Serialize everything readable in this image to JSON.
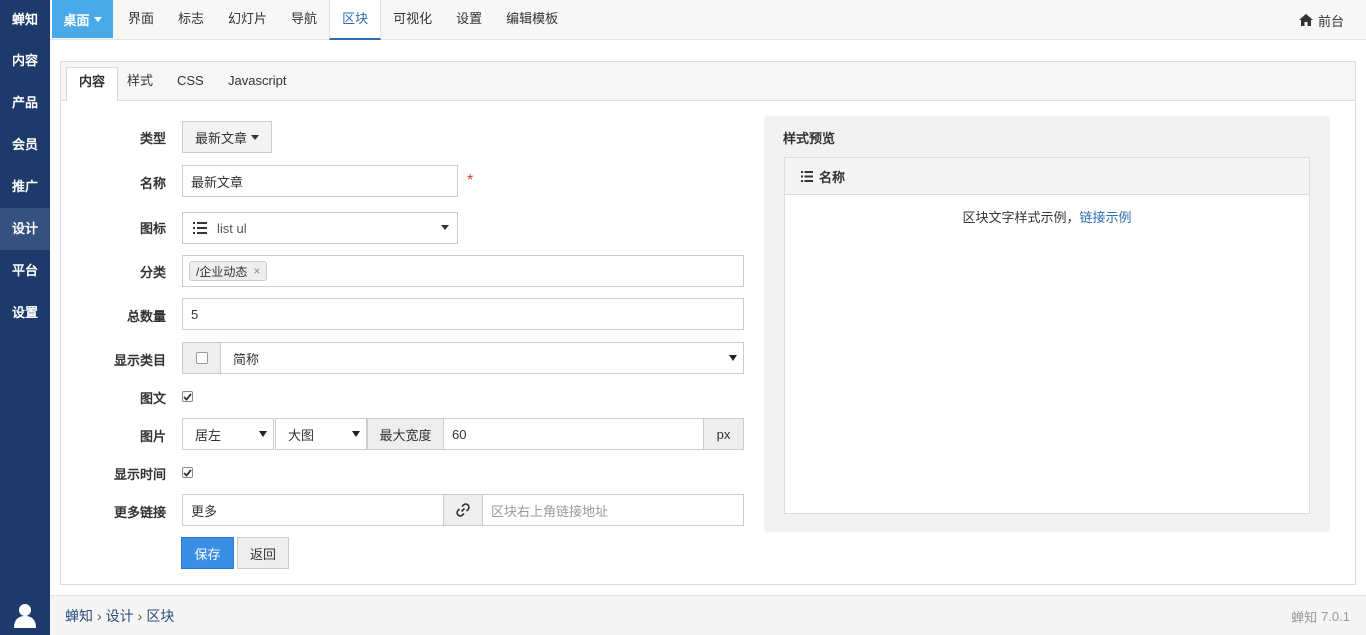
{
  "sidebar": {
    "logo": "蝉知",
    "items": [
      {
        "label": "内容"
      },
      {
        "label": "产品"
      },
      {
        "label": "会员"
      },
      {
        "label": "推广"
      },
      {
        "label": "设计"
      },
      {
        "label": "平台"
      },
      {
        "label": "设置"
      }
    ],
    "active_index": 4
  },
  "topbar": {
    "desktop_label": "桌面",
    "nav": [
      "界面",
      "标志",
      "幻灯片",
      "导航",
      "区块",
      "可视化",
      "设置",
      "编辑模板"
    ],
    "active_nav": "区块",
    "front_label": "前台"
  },
  "tabs": [
    "内容",
    "样式",
    "CSS",
    "Javascript"
  ],
  "form": {
    "type_label": "类型",
    "type_value": "最新文章",
    "name_label": "名称",
    "name_value": "最新文章",
    "required_mark": "*",
    "icon_label": "图标",
    "icon_value": "list ul",
    "category_label": "分类",
    "category_tag": "/企业动态",
    "category_tag_remove": "×",
    "total_label": "总数量",
    "total_value": "5",
    "show_category_label": "显示类目",
    "show_category_select": "简称",
    "show_category_checked": false,
    "image_text_label": "图文",
    "image_text_checked": true,
    "image_label": "图片",
    "image_position": "居左",
    "image_size": "大图",
    "max_width_label": "最大宽度",
    "max_width_value": "60",
    "max_width_unit": "px",
    "show_time_label": "显示时间",
    "show_time_checked": true,
    "more_link_label": "更多链接",
    "more_link_text": "更多",
    "more_link_placeholder": "区块右上角链接地址",
    "save_label": "保存",
    "back_label": "返回"
  },
  "preview": {
    "title": "样式预览",
    "box_title": "名称",
    "body_text": "区块文字样式示例，",
    "body_link": "链接示例"
  },
  "footer": {
    "breadcrumb": [
      "蝉知",
      "设计",
      "区块"
    ],
    "version_logo": "蝉知",
    "version": "7.0.1"
  },
  "colors": {
    "sidebar_bg": "#1d3a6b",
    "accent": "#4aa9e9",
    "primary_button": "#3a8ee6",
    "link": "#2d6db5",
    "required": "#e0412b"
  }
}
